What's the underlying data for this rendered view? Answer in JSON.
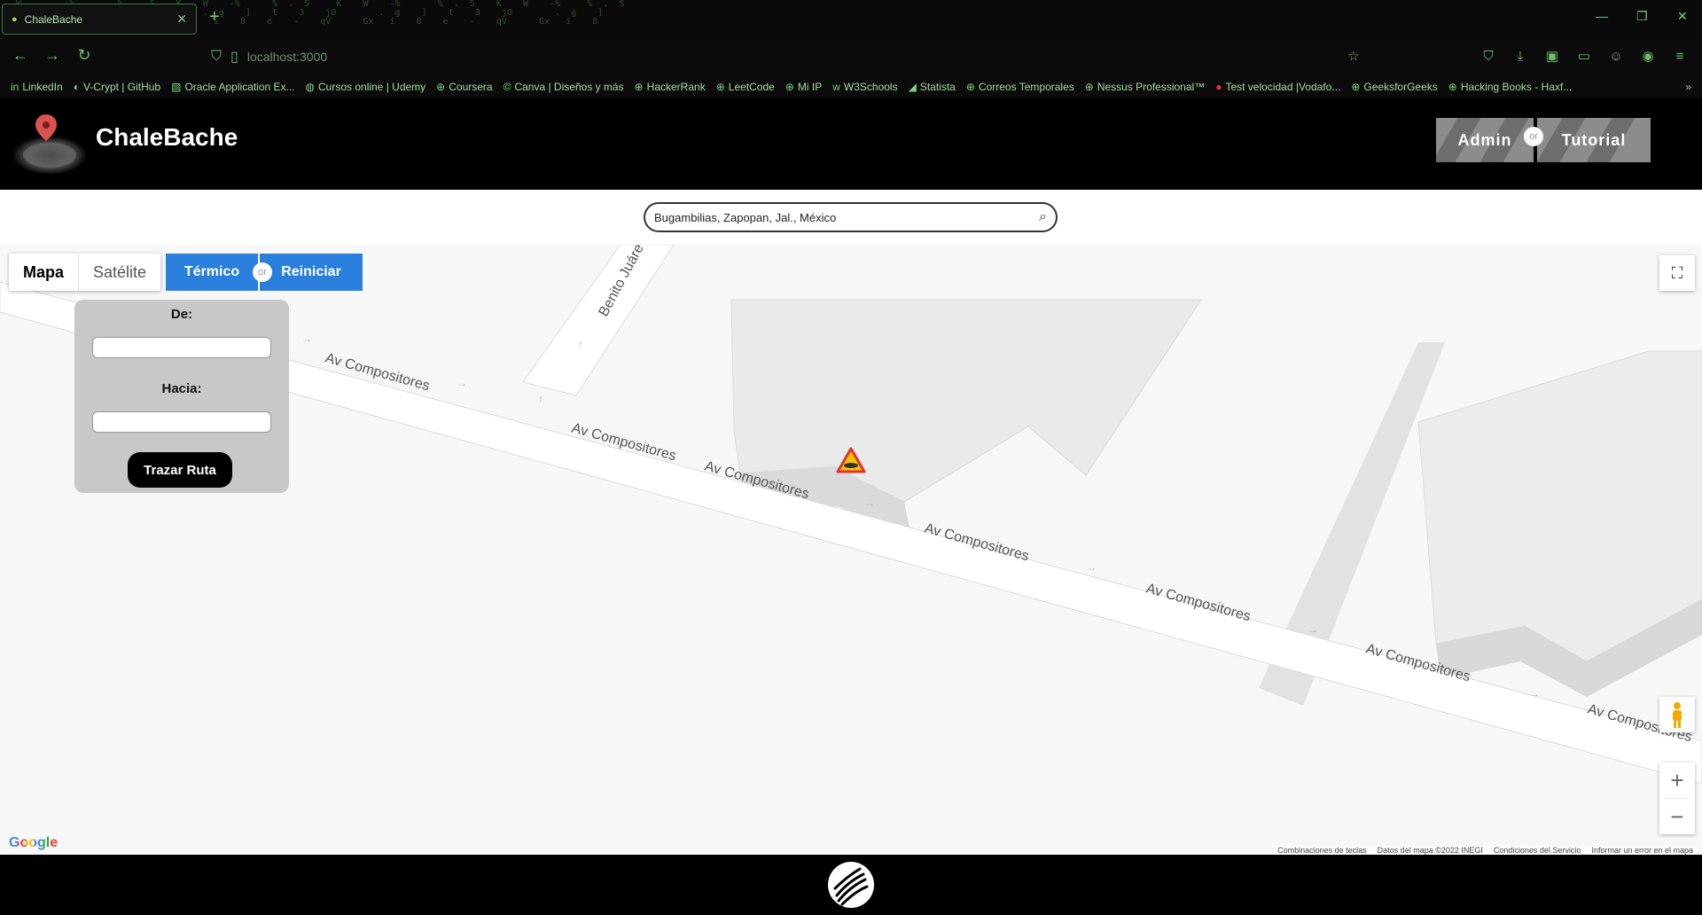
{
  "browser": {
    "tab_title": "ChaleBache",
    "url": "localhost:3000",
    "bookmarks": [
      "LinkedIn",
      "V-Crypt | GitHub",
      "Oracle Application Ex...",
      "Cursos online | Udemy",
      "Coursera",
      "Canva | Diseños y más",
      "HackerRank",
      "LeetCode",
      "Mi IP",
      "W3Schools",
      "Statista",
      "Correos Temporales",
      "Nessus Professional™",
      "Test velocidad |Vodafo...",
      "GeeksforGeeks",
      "Hacking Books - Haxf..."
    ]
  },
  "header": {
    "title": "ChaleBache",
    "admin_label": "Admin",
    "or_label": "or",
    "tutorial_label": "Tutorial"
  },
  "search": {
    "value": "Bugambilias, Zapopan, Jal., México"
  },
  "map": {
    "type_mapa": "Mapa",
    "type_satelite": "Satélite",
    "termico_label": "Térmico",
    "or_label": "or",
    "reiniciar_label": "Reiniciar",
    "street_main": "Av Compositores",
    "street_cross": "Benito Juáre",
    "google_logo": "Google",
    "attribution": [
      "Combinaciones de teclas",
      "Datos del mapa ©2022 INEGI",
      "Condiciones del Servicio",
      "Informar un error en el mapa"
    ]
  },
  "route_panel": {
    "from_label": "De:",
    "to_label": "Hacia:",
    "from_value": "",
    "to_value": "",
    "button_label": "Trazar Ruta"
  },
  "colors": {
    "accent_blue": "#2a7fdc",
    "header_button": "#8c8c8c",
    "panel_bg": "#c8c8c8"
  }
}
